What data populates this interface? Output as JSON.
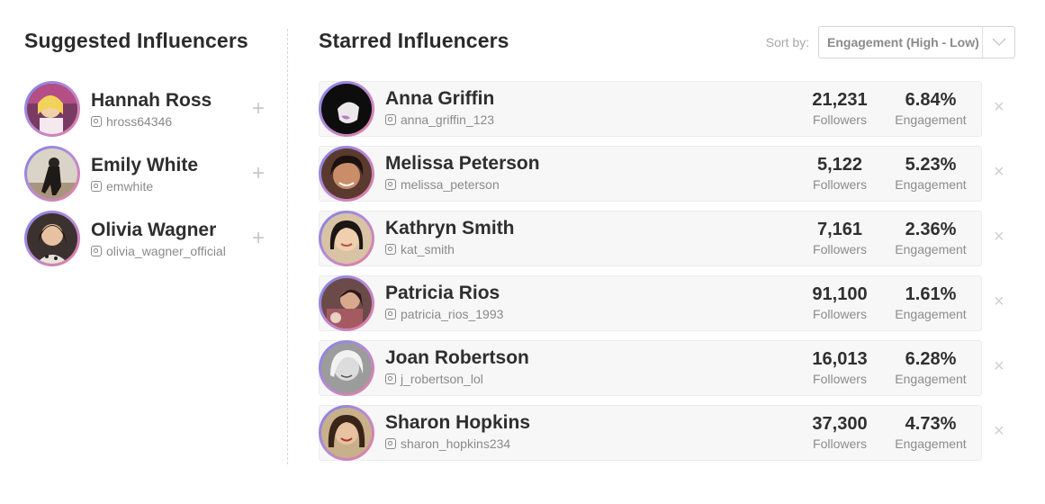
{
  "suggested": {
    "title": "Suggested Influencers",
    "items": [
      {
        "name": "Hannah Ross",
        "handle": "hross64346",
        "add_label": "+"
      },
      {
        "name": "Emily White",
        "handle": "emwhite",
        "add_label": "+"
      },
      {
        "name": "Olivia Wagner",
        "handle": "olivia_wagner_official",
        "add_label": "+"
      }
    ]
  },
  "starred": {
    "title": "Starred Influencers",
    "sort_label": "Sort by:",
    "sort_value": "Engagement (High - Low)",
    "followers_label": "Followers",
    "engagement_label": "Engagement",
    "remove_label": "×",
    "items": [
      {
        "name": "Anna Griffin",
        "handle": "anna_griffin_123",
        "followers": "21,231",
        "engagement": "6.84%"
      },
      {
        "name": "Melissa Peterson",
        "handle": "melissa_peterson",
        "followers": "5,122",
        "engagement": "5.23%"
      },
      {
        "name": "Kathryn Smith",
        "handle": "kat_smith",
        "followers": "7,161",
        "engagement": "2.36%"
      },
      {
        "name": "Patricia Rios",
        "handle": "patricia_rios_1993",
        "followers": "91,100",
        "engagement": "1.61%"
      },
      {
        "name": "Joan Robertson",
        "handle": "j_robertson_lol",
        "followers": "16,013",
        "engagement": "6.28%"
      },
      {
        "name": "Sharon Hopkins",
        "handle": "sharon_hopkins234",
        "followers": "37,300",
        "engagement": "4.73%"
      }
    ]
  },
  "colors": {
    "avatar_ring_start": "#7d84e6",
    "avatar_ring_end": "#e67e9a",
    "card_bg": "#f7f7f7"
  }
}
